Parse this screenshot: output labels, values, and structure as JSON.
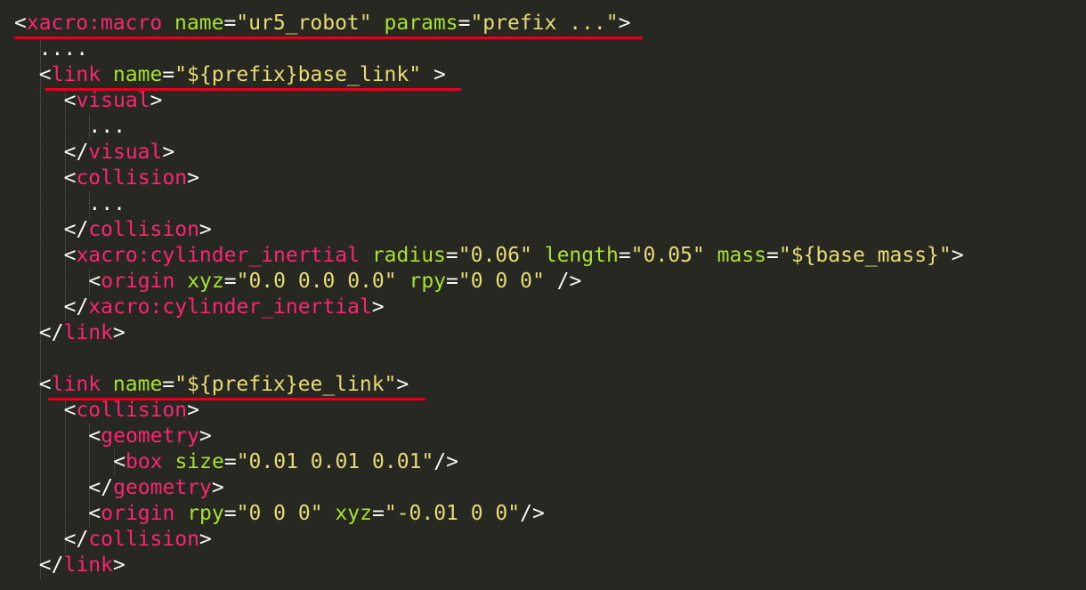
{
  "colors": {
    "background": "#272822",
    "punct": "#f8f8f2",
    "tag": "#f92672",
    "attr": "#a6e22e",
    "string": "#e6db74",
    "annotation": "#e6001e"
  },
  "lines": [
    {
      "indent": 0,
      "tokens": [
        [
          "punct",
          "<"
        ],
        [
          "tag",
          "xacro:macro"
        ],
        [
          "punct",
          " "
        ],
        [
          "attr",
          "name"
        ],
        [
          "punct",
          "="
        ],
        [
          "string",
          "\"ur5_robot\""
        ],
        [
          "punct",
          " "
        ],
        [
          "attr",
          "params"
        ],
        [
          "punct",
          "="
        ],
        [
          "string",
          "\"prefix ...\""
        ],
        [
          "punct",
          ">"
        ]
      ]
    },
    {
      "indent": 0,
      "tokens": [
        [
          "punct",
          "  ...."
        ]
      ]
    },
    {
      "indent": 1,
      "tokens": [
        [
          "punct",
          "<"
        ],
        [
          "tag",
          "link"
        ],
        [
          "punct",
          " "
        ],
        [
          "attr",
          "name"
        ],
        [
          "punct",
          "="
        ],
        [
          "string",
          "\"${prefix}base_link\""
        ],
        [
          "punct",
          " >"
        ]
      ]
    },
    {
      "indent": 2,
      "tokens": [
        [
          "punct",
          "<"
        ],
        [
          "tag",
          "visual"
        ],
        [
          "punct",
          ">"
        ]
      ]
    },
    {
      "indent": 3,
      "tokens": [
        [
          "punct",
          "..."
        ]
      ]
    },
    {
      "indent": 2,
      "tokens": [
        [
          "punct",
          "</"
        ],
        [
          "tag",
          "visual"
        ],
        [
          "punct",
          ">"
        ]
      ]
    },
    {
      "indent": 2,
      "tokens": [
        [
          "punct",
          "<"
        ],
        [
          "tag",
          "collision"
        ],
        [
          "punct",
          ">"
        ]
      ]
    },
    {
      "indent": 3,
      "tokens": [
        [
          "punct",
          "..."
        ]
      ]
    },
    {
      "indent": 2,
      "tokens": [
        [
          "punct",
          "</"
        ],
        [
          "tag",
          "collision"
        ],
        [
          "punct",
          ">"
        ]
      ]
    },
    {
      "indent": 2,
      "tokens": [
        [
          "punct",
          "<"
        ],
        [
          "tag",
          "xacro:cylinder_inertial"
        ],
        [
          "punct",
          " "
        ],
        [
          "attr",
          "radius"
        ],
        [
          "punct",
          "="
        ],
        [
          "string",
          "\"0.06\""
        ],
        [
          "punct",
          " "
        ],
        [
          "attr",
          "length"
        ],
        [
          "punct",
          "="
        ],
        [
          "string",
          "\"0.05\""
        ],
        [
          "punct",
          " "
        ],
        [
          "attr",
          "mass"
        ],
        [
          "punct",
          "="
        ],
        [
          "string",
          "\"${base_mass}\""
        ],
        [
          "punct",
          ">"
        ]
      ]
    },
    {
      "indent": 3,
      "tokens": [
        [
          "punct",
          "<"
        ],
        [
          "tag",
          "origin"
        ],
        [
          "punct",
          " "
        ],
        [
          "attr",
          "xyz"
        ],
        [
          "punct",
          "="
        ],
        [
          "string",
          "\"0.0 0.0 0.0\""
        ],
        [
          "punct",
          " "
        ],
        [
          "attr",
          "rpy"
        ],
        [
          "punct",
          "="
        ],
        [
          "string",
          "\"0 0 0\""
        ],
        [
          "punct",
          " />"
        ]
      ]
    },
    {
      "indent": 2,
      "tokens": [
        [
          "punct",
          "</"
        ],
        [
          "tag",
          "xacro:cylinder_inertial"
        ],
        [
          "punct",
          ">"
        ]
      ]
    },
    {
      "indent": 1,
      "tokens": [
        [
          "punct",
          "</"
        ],
        [
          "tag",
          "link"
        ],
        [
          "punct",
          ">"
        ]
      ]
    },
    {
      "indent": 0,
      "tokens": []
    },
    {
      "indent": 1,
      "tokens": [
        [
          "punct",
          "<"
        ],
        [
          "tag",
          "link"
        ],
        [
          "punct",
          " "
        ],
        [
          "attr",
          "name"
        ],
        [
          "punct",
          "="
        ],
        [
          "string",
          "\"${prefix}ee_link\""
        ],
        [
          "punct",
          ">"
        ]
      ]
    },
    {
      "indent": 2,
      "tokens": [
        [
          "punct",
          "<"
        ],
        [
          "tag",
          "collision"
        ],
        [
          "punct",
          ">"
        ]
      ]
    },
    {
      "indent": 3,
      "tokens": [
        [
          "punct",
          "<"
        ],
        [
          "tag",
          "geometry"
        ],
        [
          "punct",
          ">"
        ]
      ]
    },
    {
      "indent": 4,
      "tokens": [
        [
          "punct",
          "<"
        ],
        [
          "tag",
          "box"
        ],
        [
          "punct",
          " "
        ],
        [
          "attr",
          "size"
        ],
        [
          "punct",
          "="
        ],
        [
          "string",
          "\"0.01 0.01 0.01\""
        ],
        [
          "punct",
          "/>"
        ]
      ]
    },
    {
      "indent": 3,
      "tokens": [
        [
          "punct",
          "</"
        ],
        [
          "tag",
          "geometry"
        ],
        [
          "punct",
          ">"
        ]
      ]
    },
    {
      "indent": 3,
      "tokens": [
        [
          "punct",
          "<"
        ],
        [
          "tag",
          "origin"
        ],
        [
          "punct",
          " "
        ],
        [
          "attr",
          "rpy"
        ],
        [
          "punct",
          "="
        ],
        [
          "string",
          "\"0 0 0\""
        ],
        [
          "punct",
          " "
        ],
        [
          "attr",
          "xyz"
        ],
        [
          "punct",
          "="
        ],
        [
          "string",
          "\"-0.01 0 0\""
        ],
        [
          "punct",
          "/>"
        ]
      ]
    },
    {
      "indent": 2,
      "tokens": [
        [
          "punct",
          "</"
        ],
        [
          "tag",
          "collision"
        ],
        [
          "punct",
          ">"
        ]
      ]
    },
    {
      "indent": 1,
      "tokens": [
        [
          "punct",
          "</"
        ],
        [
          "tag",
          "link"
        ],
        [
          "punct",
          ">"
        ]
      ]
    }
  ]
}
